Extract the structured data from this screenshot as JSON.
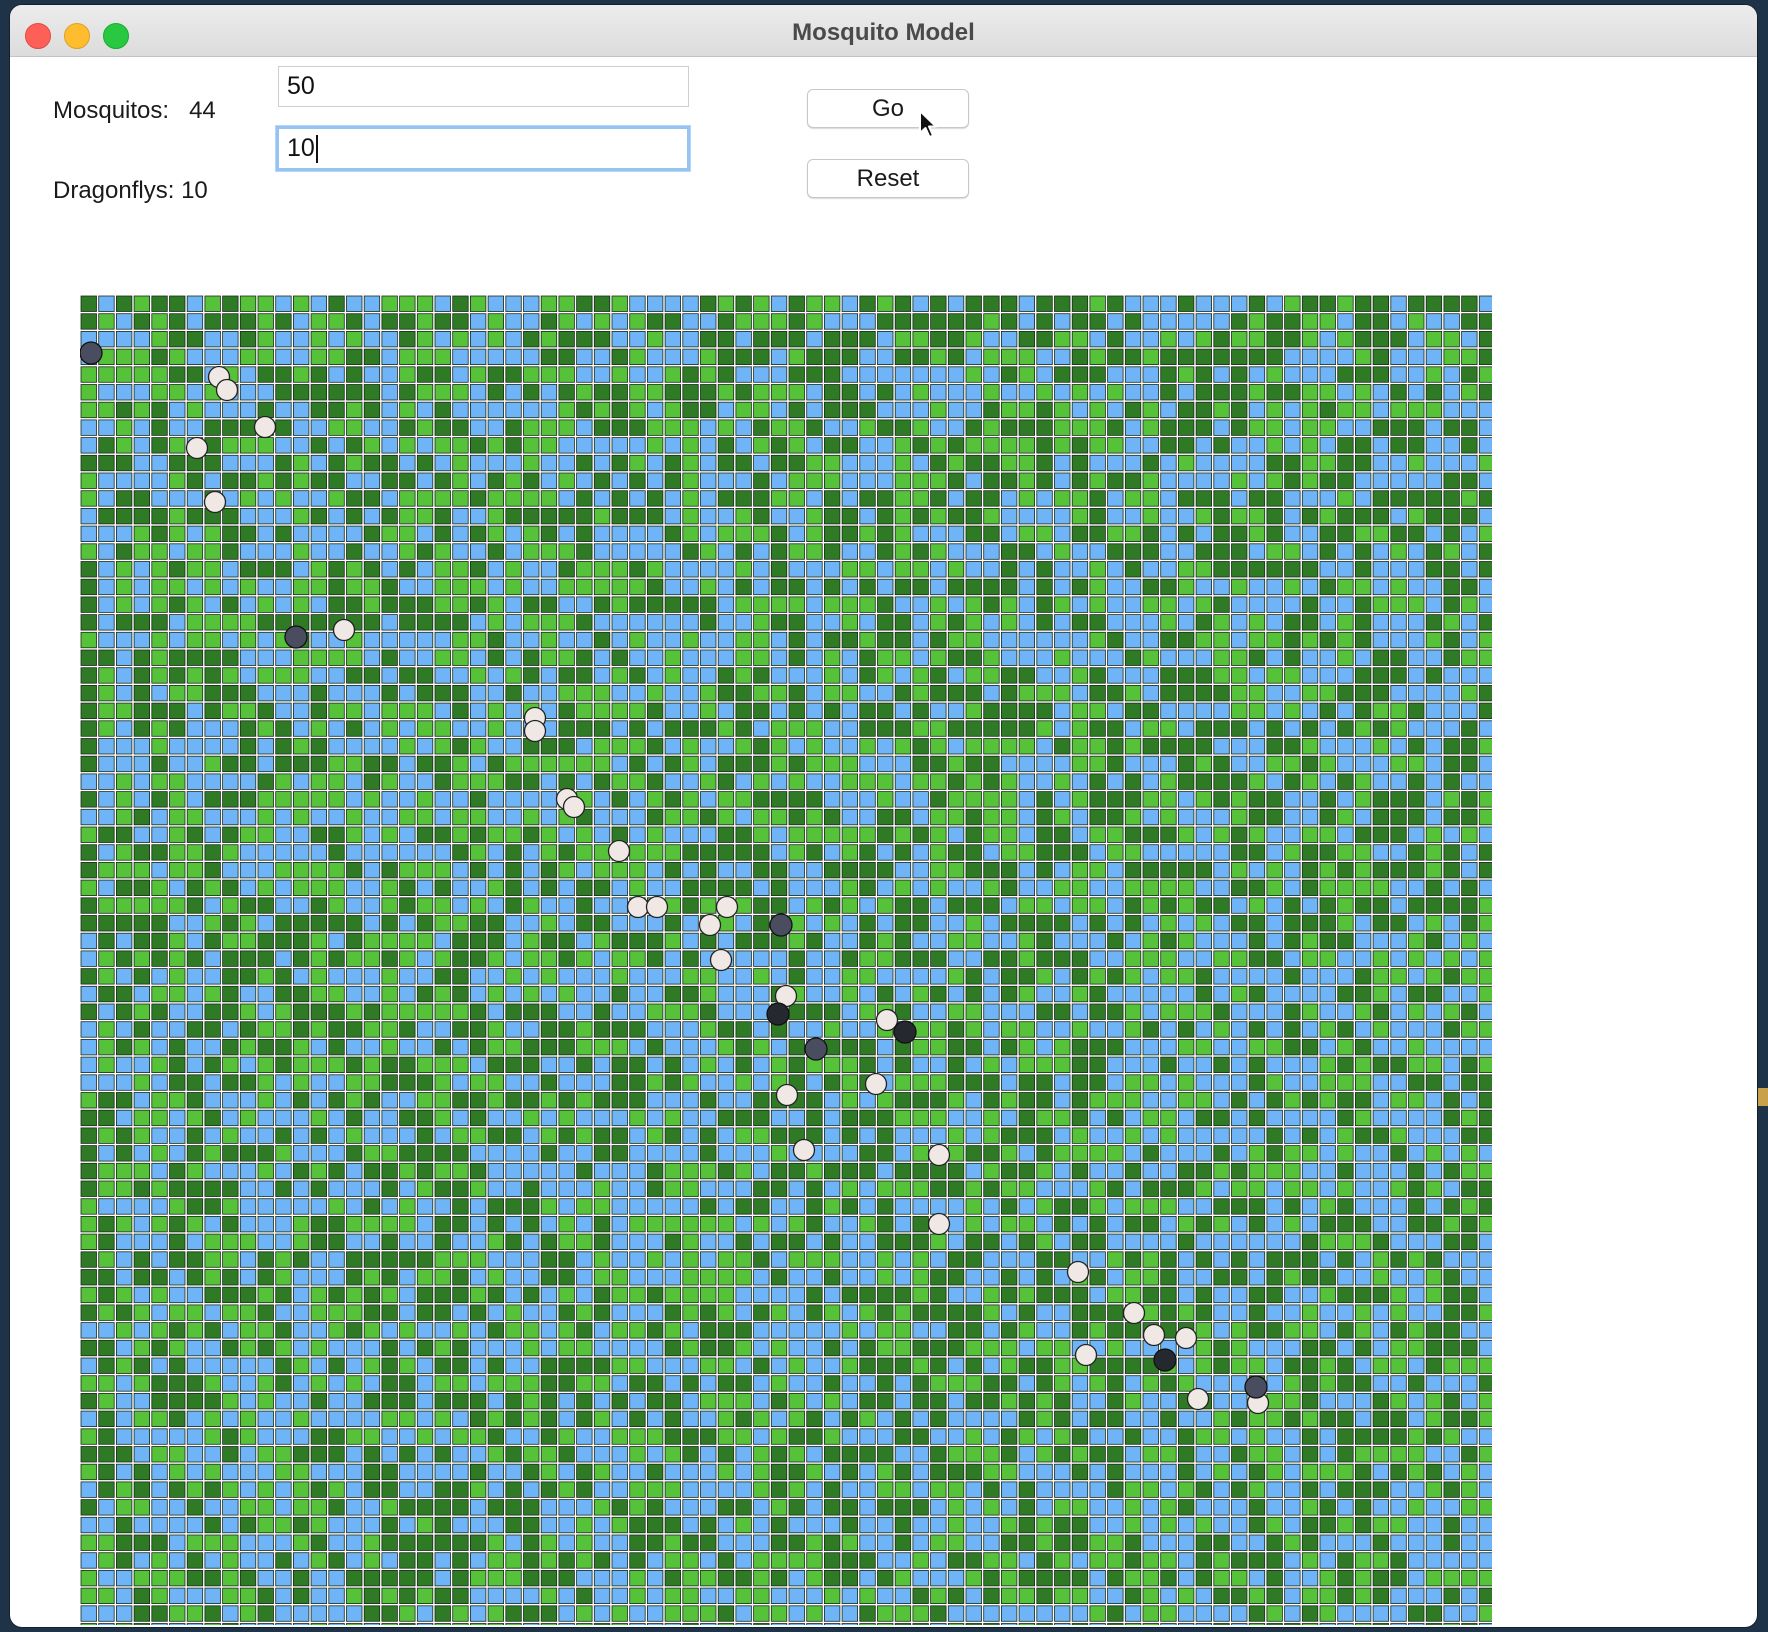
{
  "window": {
    "title": "Mosquito Model"
  },
  "stats": {
    "mosquitos_label": "Mosquitos:",
    "mosquitos_value": "44",
    "dragonflys_label": "Dragonflys:",
    "dragonflys_value": "10"
  },
  "inputs": {
    "mosquito_count": "50",
    "dragonfly_count": "10"
  },
  "buttons": {
    "go": "Go",
    "reset": "Reset"
  },
  "colors": {
    "water": "#6eb4f7",
    "grass_dark": "#2f7a25",
    "grass_light": "#55c23a",
    "mosquito": "#efe8e4",
    "dragonfly": "#4a4c60",
    "dragonfly_dark": "#26282f"
  },
  "icons": [
    "pointer-cursor-icon"
  ]
}
